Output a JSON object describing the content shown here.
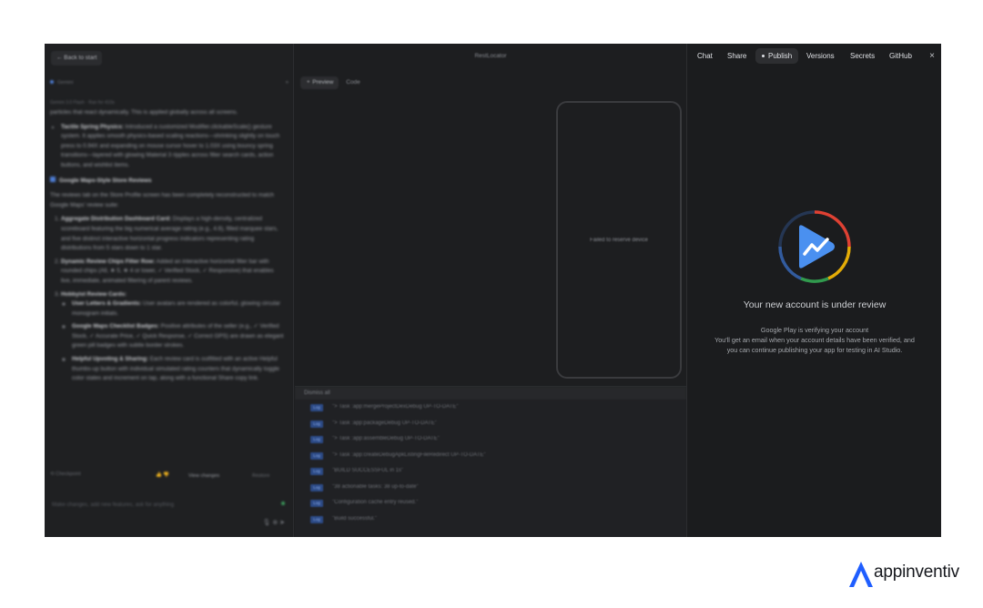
{
  "left_panel": {
    "back_button": "← Back to start",
    "subheader": "Gemini",
    "plus": "+",
    "meta": "Gemini 3.0 Flash · Ran for 410s",
    "chat_paragraphs": [
      "particles that react dynamically. This is applied globally across all screens.",
      "Google Maps-Style Store Reviews",
      "The reviews tab on the Store Profile screen has been completely reconstructed to match Google Maps' review suite:"
    ],
    "bullets_top": [
      {
        "bold": "Tactile Spring Physics:",
        "text": " Introduced a customized Modifier.clickableScale() gesture system. It applies smooth physics-based scaling reactions—shrinking slightly on touch press to 0.94X and expanding on mouse cursor hover to 1.03X using bouncy spring transitions—layered with glowing Material 3 ripples across filter search cards, action buttons, and wishlist items."
      }
    ],
    "numbered": [
      {
        "bold": "Aggregate Distribution Dashboard Card:",
        "text": " Displays a high-density, centralized scoreboard featuring the big numerical average rating (e.g., 4.6), filled marquee stars, and five distinct interactive horizontal progress indicators representing rating distributions from 5 stars down to 1 star."
      },
      {
        "bold": "Dynamic Review Chips Filter Row:",
        "text": " Added an interactive horizontal filter bar with rounded chips (All, ★ 5, ★ 4 or lower, ✓ Verified Stock, ✓ Responsive) that enables live, immediate, animated filtering of parent reviews."
      },
      {
        "bold": "Hobbyist Review Cards:",
        "text": ""
      }
    ],
    "sub_bullets": [
      {
        "bold": "User Letters & Gradients:",
        "text": " User avatars are rendered as colorful, glowing circular monogram initials."
      },
      {
        "bold": "Google Maps Checklist Badges:",
        "text": " Positive attributes of the seller (e.g., ✓ Verified Stock, ✓ Accurate Price, ✓ Quick Response, ✓ Correct GPS) are drawn as elegant green pill badges with subtle border strokes."
      },
      {
        "bold": "Helpful Upvoting & Sharing:",
        "text": " Each review card is outfitted with an active Helpful thumbs-up button with individual simulated rating counters that dynamically toggle color states and increment on tap, along with a functional Share copy link."
      }
    ],
    "checkpoint": "⟲ Checkpoint",
    "thumbs": "👍 👎",
    "view_changes": "View changes",
    "restore": "Restore",
    "input_placeholder": "Make changes, add new features, ask for anything",
    "tools": "🎙 ⊕ ➤"
  },
  "middle_panel": {
    "title": "RestLocator",
    "tabs": [
      "⚬ Preview",
      "Code"
    ],
    "device_message": "Failed to reserve device",
    "dismiss_all": "Dismiss all",
    "log_badge": "Log",
    "logs": [
      "\"> Task :app:mergeProjectDexDebug UP-TO-DATE\"",
      "\"> Task :app:packageDebug UP-TO-DATE\"",
      "\"> Task :app:assembleDebug UP-TO-DATE\"",
      "\"> Task :app:createDebugApkListingFileRedirect UP-TO-DATE\"",
      "\"BUILD SUCCESSFUL in 1s\"",
      "\"38 actionable tasks: 38 up-to-date\"",
      "\"Configuration cache entry reused.\"",
      "\"Build successful.\""
    ]
  },
  "right_panel": {
    "nav": [
      "Chat",
      "Share",
      "Publish",
      "Versions",
      "Secrets",
      "GitHub"
    ],
    "close": "×",
    "review_title": "Your new account is under review",
    "review_line1": "Google Play is verifying your account",
    "review_line2": "You'll get an email when your account details have been verified, and you can continue publishing your app for testing in AI Studio.",
    "logo_icon": "google-play-console-icon"
  },
  "brand": {
    "name": "appinventiv",
    "color": "#1f5eff"
  }
}
